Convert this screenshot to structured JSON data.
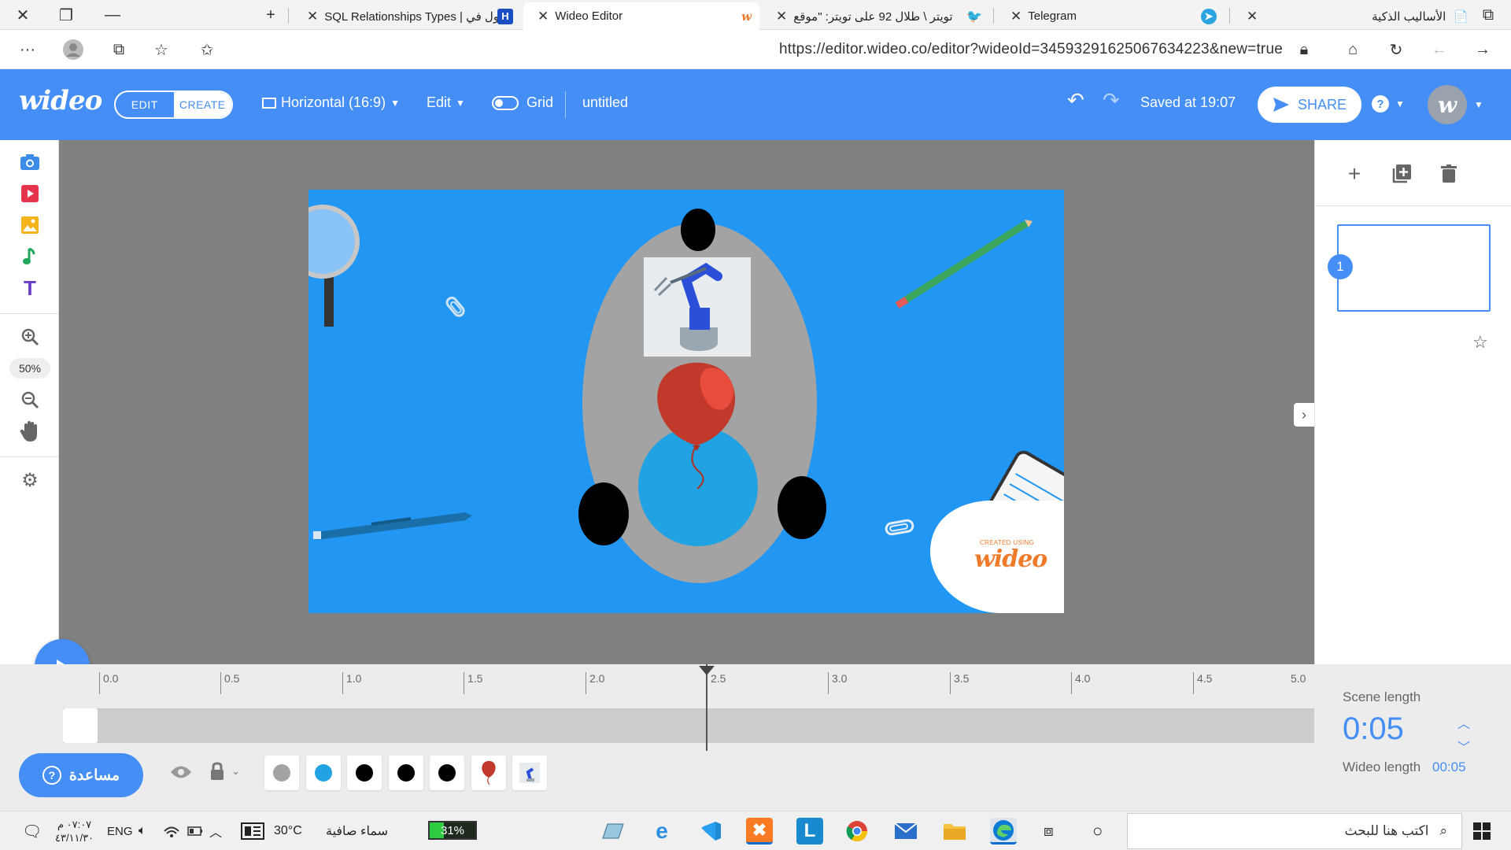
{
  "browser": {
    "tabs": [
      {
        "title": "الأساليب الذكية",
        "active": false
      },
      {
        "title": "Telegram",
        "active": false
      },
      {
        "title": "تويتر \\ طلال 92 على تويتر: \"موقع",
        "active": false
      },
      {
        "title": "Wideo Editor",
        "active": true
      },
      {
        "title": "SQL Relationships Types | ول في",
        "active": false
      }
    ],
    "url": "https://editor.wideo.co/editor?wideoId=34593291625067634223&new=true"
  },
  "header": {
    "logo": "wideo",
    "mode_edit": "EDIT",
    "mode_create": "CREATE",
    "aspect": "Horizontal (16:9)",
    "edit_menu": "Edit",
    "grid_label": "Grid",
    "title": "untitled",
    "saved_status": "Saved at 19:07",
    "share_label": "SHARE",
    "help_label": "?",
    "avatar_initial": "w"
  },
  "toolbar": {
    "zoom_level": "50%"
  },
  "canvas": {
    "background_color": "#2196f3",
    "badge_small": "CREATED USING",
    "badge_logo": "wideo"
  },
  "scenes": {
    "items": [
      {
        "number": "1"
      }
    ]
  },
  "timeline": {
    "ticks": [
      "0.0",
      "0.5",
      "1.0",
      "1.5",
      "2.0",
      "2.5",
      "3.0",
      "3.5",
      "4.0",
      "4.5",
      "5.0"
    ],
    "playhead_time": 2.5,
    "scene_length_label": "Scene length",
    "scene_length_value": "0:05",
    "wideo_length_label": "Wideo length",
    "wideo_length_value": "00:05",
    "help_button": "مساعدة",
    "layers": [
      "gray-ellipse",
      "blue-circle",
      "black-dot",
      "black-dot",
      "black-dot",
      "red-balloon",
      "robot-image"
    ]
  },
  "taskbar": {
    "time": "٠٧:٠٧ م",
    "date": "٤٣/١١/٣٠",
    "language": "ENG",
    "temperature": "30°C",
    "weather": "سماء صافية",
    "battery": "31%",
    "search_placeholder": "اكتب هنا للبحث"
  },
  "colors": {
    "accent": "#448ef6",
    "workspace": "#808080"
  }
}
